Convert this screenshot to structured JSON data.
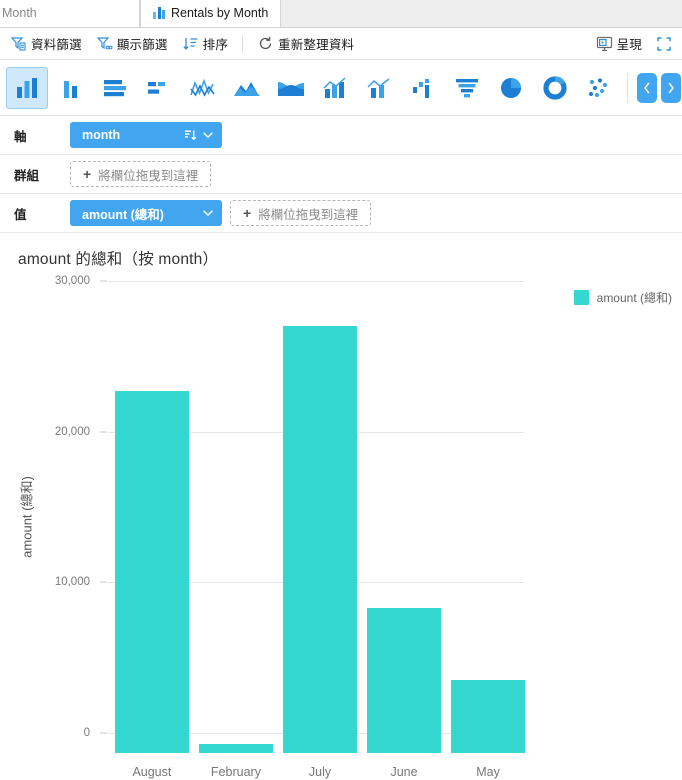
{
  "tabs": [
    {
      "label": "Month",
      "icon": "none",
      "active": false,
      "partial": true
    },
    {
      "label": "Rentals by Month",
      "icon": "bar-chart-icon",
      "active": true,
      "partial": false
    }
  ],
  "toolbar": {
    "items": [
      {
        "label": "資料篩選",
        "icon": "data-filter-icon"
      },
      {
        "label": "顯示篩選",
        "icon": "display-filter-icon"
      },
      {
        "label": "排序",
        "icon": "sort-icon"
      },
      {
        "label": "重新整理資料",
        "icon": "refresh-icon"
      }
    ],
    "present_label": "呈現",
    "present_icon": "present-icon",
    "fullscreen_icon": "fullscreen-icon"
  },
  "chart_types": [
    {
      "name": "column-chart-icon",
      "selected": true
    },
    {
      "name": "column-chart-grouped-icon",
      "selected": false
    },
    {
      "name": "bar-chart-icon",
      "selected": false
    },
    {
      "name": "bar-chart-grouped-icon",
      "selected": false
    },
    {
      "name": "line-chart-icon",
      "selected": false
    },
    {
      "name": "area-chart-icon",
      "selected": false
    },
    {
      "name": "stacked-area-chart-icon",
      "selected": false
    },
    {
      "name": "combo-line-column-icon",
      "selected": false
    },
    {
      "name": "combo-line-bar-icon",
      "selected": false
    },
    {
      "name": "waterfall-chart-icon",
      "selected": false
    },
    {
      "name": "funnel-chart-icon",
      "selected": false
    },
    {
      "name": "pie-chart-icon",
      "selected": false
    },
    {
      "name": "donut-chart-icon",
      "selected": false
    },
    {
      "name": "scatter-chart-icon",
      "selected": false
    }
  ],
  "nav": {
    "prev_icon": "chevron-left-icon",
    "next_icon": "chevron-right-icon"
  },
  "shelves": {
    "axis": {
      "label": "軸",
      "pill": {
        "text": "month",
        "sort_icon": "sort-descending-icon",
        "menu_icon": "chevron-down-icon"
      }
    },
    "group": {
      "label": "群組",
      "dropzone": "將欄位拖曳到這裡"
    },
    "value": {
      "label": "值",
      "pill": {
        "text": "amount (總和)",
        "menu_icon": "chevron-down-icon"
      },
      "dropzone": "將欄位拖曳到這裡"
    }
  },
  "colors": {
    "bar": "#35d8d0",
    "pill": "#41a5f0",
    "accent": "#2f8fd8",
    "grid": "#e6e6e6"
  },
  "chart_data": {
    "type": "bar",
    "title": "amount 的總和（按 month）",
    "xlabel": "",
    "ylabel": "amount (總和)",
    "categories": [
      "August",
      "February",
      "July",
      "June",
      "May"
    ],
    "values": [
      24050,
      600,
      28350,
      9600,
      4850
    ],
    "ylim": [
      0,
      30000
    ],
    "yticks": [
      0,
      10000,
      20000,
      30000
    ],
    "ytick_labels": [
      "0",
      "10,000",
      "20,000",
      "30,000"
    ],
    "grid": true,
    "legend": {
      "position": "right",
      "entries": [
        "amount (總和)"
      ]
    },
    "series": [
      {
        "name": "amount (總和)",
        "values": [
          24050,
          600,
          28350,
          9600,
          4850
        ]
      }
    ]
  }
}
